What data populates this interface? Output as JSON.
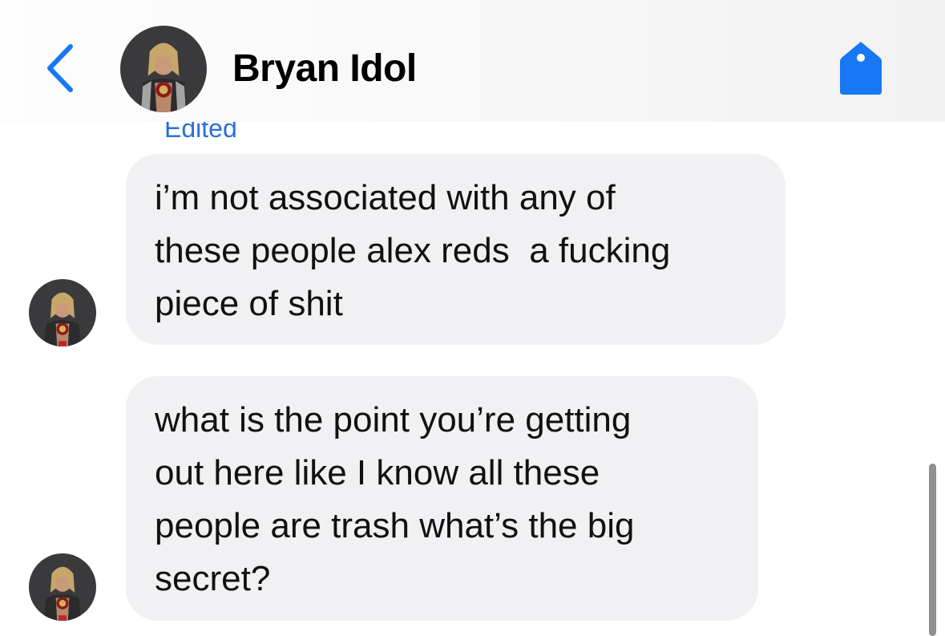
{
  "header": {
    "contact_name": "Bryan Idol",
    "back_icon": "chevron-left-icon",
    "tag_icon": "tag-icon",
    "accent_color": "#1877F2"
  },
  "conversation": {
    "edited_label": "Edited",
    "messages": [
      {
        "text": "i’m not associated with any of\nthese people alex reds  a fucking\npiece of shit"
      },
      {
        "text": "what is the point you’re getting\nout here like I know all these\npeople are trash what’s the big\nsecret?"
      }
    ]
  }
}
